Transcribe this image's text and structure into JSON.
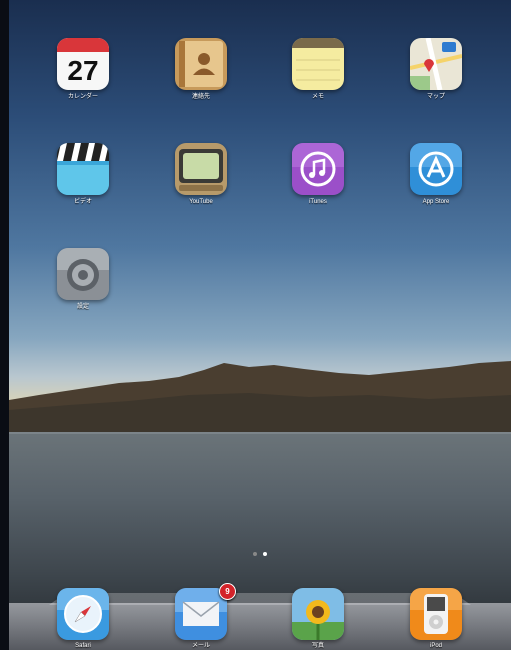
{
  "home": {
    "apps": [
      {
        "name": "calendar",
        "label": "カレンダー",
        "day": "27",
        "month_header": "水曜日"
      },
      {
        "name": "contacts",
        "label": "連絡先"
      },
      {
        "name": "notes",
        "label": "メモ"
      },
      {
        "name": "maps",
        "label": "マップ"
      },
      {
        "name": "videos",
        "label": "ビデオ"
      },
      {
        "name": "youtube",
        "label": "YouTube"
      },
      {
        "name": "itunes",
        "label": "iTunes"
      },
      {
        "name": "app-store",
        "label": "App Store"
      },
      {
        "name": "settings",
        "label": "設定"
      }
    ],
    "page_count": 2,
    "current_page": 2
  },
  "dock": {
    "apps": [
      {
        "name": "safari",
        "label": "Safari"
      },
      {
        "name": "mail",
        "label": "メール",
        "badge": "9"
      },
      {
        "name": "photos",
        "label": "写真"
      },
      {
        "name": "ipod",
        "label": "iPod"
      }
    ]
  },
  "colors": {
    "badge": "#d3232a",
    "calendar_red": "#d9363a",
    "itunes_purple": "#9b4fc9",
    "appstore_blue": "#2f8fd8"
  }
}
